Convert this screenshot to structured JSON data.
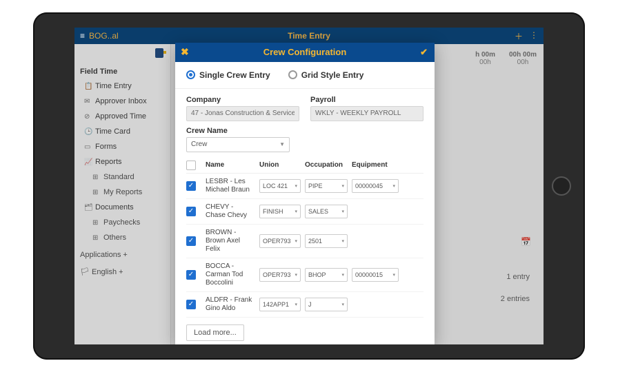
{
  "app": {
    "user": "BOG..al",
    "title": "Time Entry"
  },
  "sidebar": {
    "heading": "Field Time",
    "items": [
      {
        "icon": "📋",
        "label": "Time Entry"
      },
      {
        "icon": "✉",
        "label": "Approver Inbox"
      },
      {
        "icon": "⊘",
        "label": "Approved Time"
      },
      {
        "icon": "🕒",
        "label": "Time Card"
      },
      {
        "icon": "▭",
        "label": "Forms"
      },
      {
        "icon": "📈",
        "label": "Reports"
      }
    ],
    "subReports": [
      {
        "icon": "⊞",
        "label": "Standard"
      },
      {
        "icon": "⊞",
        "label": "My Reports"
      }
    ],
    "documents": {
      "icon": "🗂",
      "label": "Documents"
    },
    "subDocs": [
      {
        "icon": "⊞",
        "label": "Paychecks"
      },
      {
        "icon": "⊞",
        "label": "Others"
      }
    ],
    "apps": "Applications +",
    "lang": "English +"
  },
  "right": {
    "t1": {
      "a": "h 00m",
      "b": "00h"
    },
    "t2": {
      "a": "00h 00m",
      "b": "00h"
    },
    "entries1": "1 entry",
    "entries2": "2 entries"
  },
  "modal": {
    "title": "Crew Configuration",
    "radio1": "Single Crew Entry",
    "radio2": "Grid Style Entry",
    "companyLabel": "Company",
    "companyValue": "47 - Jonas Construction & Service",
    "payrollLabel": "Payroll",
    "payrollValue": "WKLY - WEEKLY PAYROLL",
    "crewLabel": "Crew Name",
    "crewValue": "Crew",
    "head": {
      "name": "Name",
      "union": "Union",
      "occ": "Occupation",
      "equip": "Equipment"
    },
    "rows": [
      {
        "name": "LESBR - Les Michael Braun",
        "union": "LOC 421",
        "occ": "PIPE",
        "equip": "00000045"
      },
      {
        "name": "CHEVY - Chase Chevy",
        "union": "FINISH",
        "occ": "SALES",
        "equip": ""
      },
      {
        "name": "BROWN - Brown Axel Felix",
        "union": "OPER793",
        "occ": "2501",
        "equip": ""
      },
      {
        "name": "BOCCA - Carman Tod Boccolini",
        "union": "OPER793",
        "occ": "BHOP",
        "equip": "00000015"
      },
      {
        "name": "ALDFR - Frank Gino Aldo",
        "union": "142APP1",
        "occ": "J",
        "equip": ""
      }
    ],
    "loadMore": "Load more..."
  }
}
